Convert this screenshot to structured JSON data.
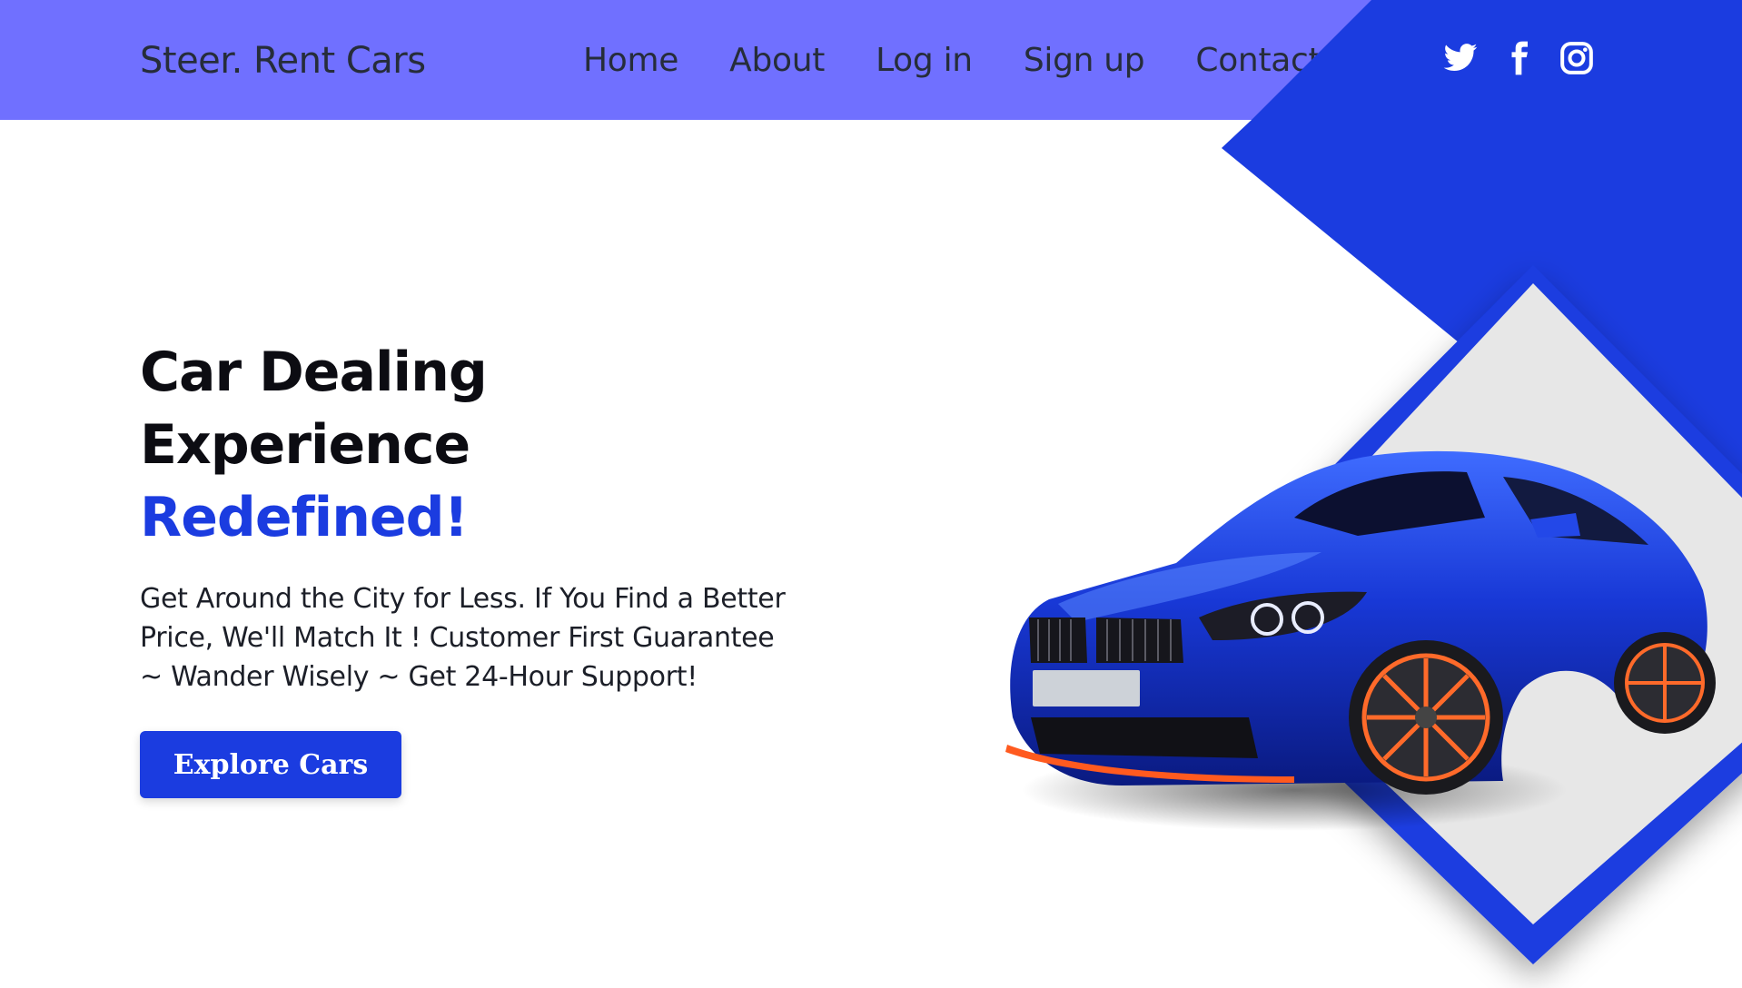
{
  "header": {
    "brand": "Steer. Rent Cars",
    "nav": [
      "Home",
      "About",
      "Log in",
      "Sign up",
      "Contact"
    ],
    "social_icons": [
      "twitter-icon",
      "facebook-icon",
      "instagram-icon"
    ]
  },
  "hero": {
    "headline_line1": "Car Dealing Experience",
    "headline_line2": "Redefined!",
    "description": "Get Around the City for Less. If You Find a Better Price, We'll Match It ! Customer First Guarantee ~ Wander Wisely ~ Get 24-Hour Support!",
    "cta_label": "Explore Cars",
    "image": "blue-sports-car"
  },
  "colors": {
    "navbar": "#7070ff",
    "accent_blue": "#1b3ce0",
    "diamond_fill": "#e7e7e7"
  }
}
